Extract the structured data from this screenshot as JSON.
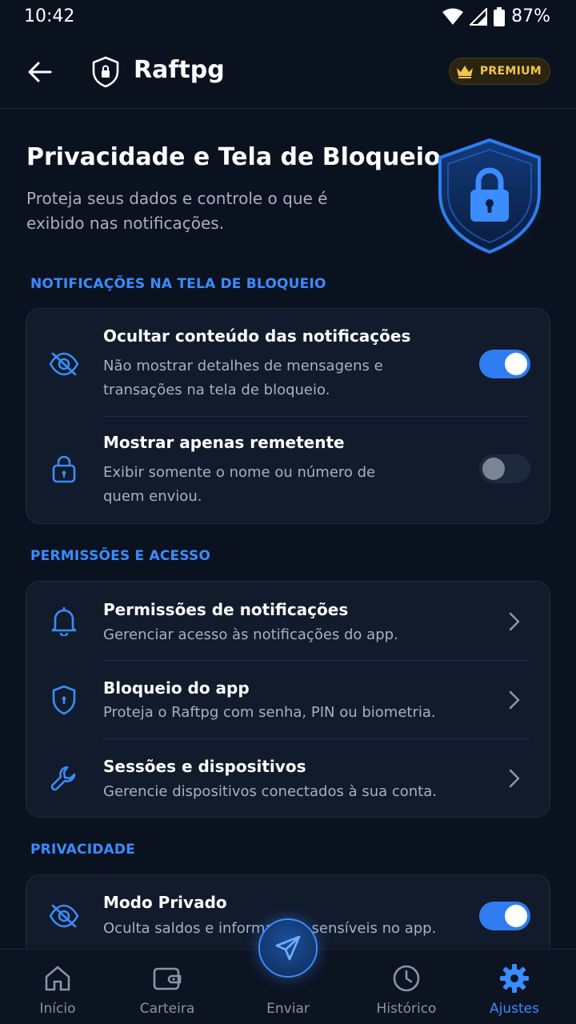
{
  "status_bar": {
    "time": "10:42",
    "battery": "87%"
  },
  "app_bar": {
    "app_name": "Raftpg",
    "premium_label": "PREMIUM"
  },
  "hero": {
    "title": "Privacidade e Tela de Bloqueio",
    "subtitle": "Proteja seus dados e controle o que é exibido nas notificações."
  },
  "sections": {
    "lock_screen": {
      "title": "NOTIFICAÇÕES NA TELA DE BLOQUEIO",
      "items": [
        {
          "title": "Ocultar conteúdo das notificações",
          "desc": "Não mostrar detalhes de mensagens e transações na tela de bloqueio.",
          "toggle": true
        },
        {
          "title": "Mostrar apenas remetente",
          "desc": "Exibir somente o nome ou número de quem enviou.",
          "toggle": false
        }
      ]
    },
    "permissions": {
      "title": "PERMISSÕES E ACESSO",
      "items": [
        {
          "title": "Permissões de notificações",
          "desc": "Gerenciar acesso às notificações do app."
        },
        {
          "title": "Bloqueio do app",
          "desc": "Proteja o Raftpg com senha, PIN ou biometria."
        },
        {
          "title": "Sessões e dispositivos",
          "desc": "Gerencie dispositivos conectados à sua conta."
        }
      ]
    },
    "privacy": {
      "title": "PRIVACIDADE",
      "items": [
        {
          "title": "Modo Privado",
          "desc": "Oculta saldos e informações sensíveis no app.",
          "toggle": true
        }
      ]
    }
  },
  "bottom_nav": {
    "items": [
      {
        "label": "Início",
        "icon": "home-icon"
      },
      {
        "label": "Carteira",
        "icon": "wallet-icon"
      },
      {
        "label": "Enviar",
        "icon": "send-icon"
      },
      {
        "label": "Histórico",
        "icon": "clock-icon"
      },
      {
        "label": "Ajustes",
        "icon": "gear-icon",
        "active": true
      }
    ]
  },
  "colors": {
    "accent": "#3b8cff",
    "background": "#0a1220",
    "card": "#111b2b",
    "premium": "#f3c44a"
  }
}
